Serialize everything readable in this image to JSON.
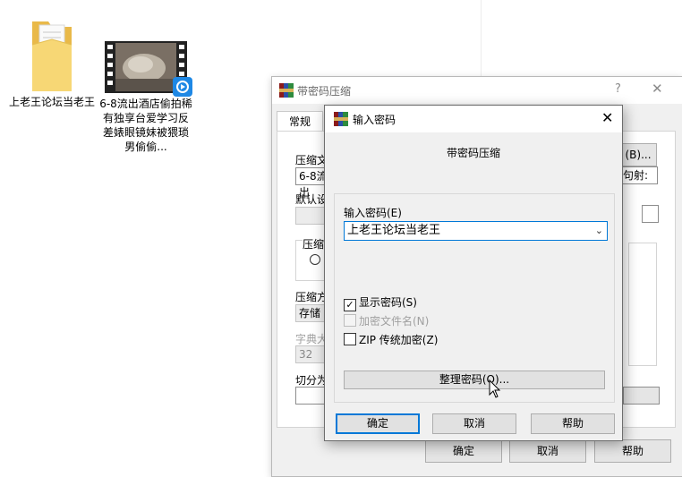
{
  "desktop": {
    "items": [
      {
        "label": "上老王论坛当老王",
        "icon": "folder-icon"
      },
      {
        "label": "6-8流出酒店偷拍稀有独享台爱学习反差婊眼镜妹被猥琐男偷偷...",
        "icon": "video-file-icon"
      }
    ]
  },
  "bg_dialog": {
    "title": "带密码压缩",
    "help": "?",
    "close": "✕",
    "tab": "常规",
    "archive_name_label": "压缩文",
    "archive_name_value": "6-8流出",
    "browse_button": "(B)...",
    "update_mode_value": "句射:",
    "default_profile_label": "默认设",
    "format_label": "压缩文",
    "method_label": "压缩方",
    "method_value": "存储",
    "dict_label": "字典大",
    "dict_value": "32",
    "split_label": "切分为",
    "ok_button": "确定",
    "cancel_button": "取消",
    "help_button": "帮助"
  },
  "fg_dialog": {
    "title": "输入密码",
    "close": "✕",
    "subtitle": "带密码压缩",
    "password_label": "输入密码(E)",
    "password_value": "上老王论坛当老王",
    "checkboxes": [
      {
        "label": "显示密码(S)",
        "checked": true,
        "disabled": false
      },
      {
        "label": "加密文件名(N)",
        "checked": false,
        "disabled": true
      },
      {
        "label": "ZIP 传统加密(Z)",
        "checked": false,
        "disabled": false
      }
    ],
    "organize_button": "整理密码(O)...",
    "ok_button": "确定",
    "cancel_button": "取消",
    "help_button": "帮助"
  }
}
